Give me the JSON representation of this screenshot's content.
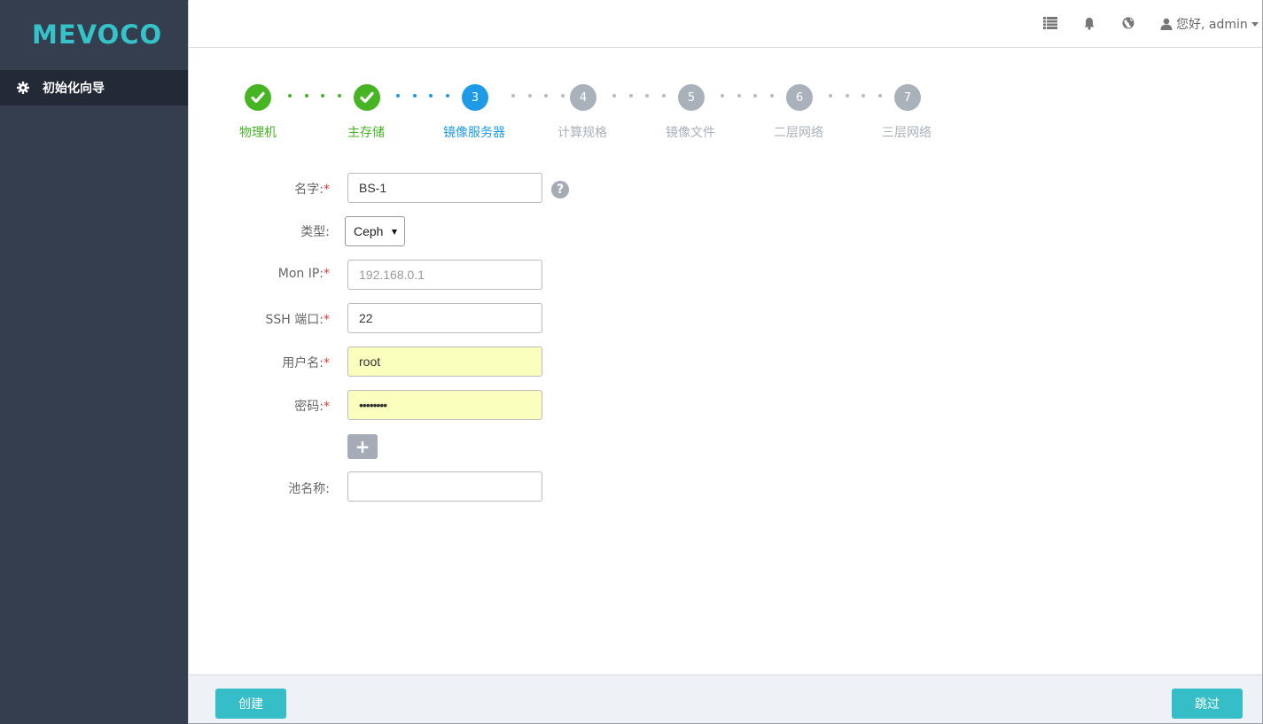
{
  "brand": {
    "logo_text": "MEVOCO",
    "accent": "#35c2c9"
  },
  "sidebar": {
    "items": [
      {
        "label": "初始化向导",
        "icon": "gear-icon"
      }
    ]
  },
  "header": {
    "icons": [
      "list-icon",
      "bell-icon",
      "globe-icon",
      "user-icon"
    ],
    "user_label": "您好, admin"
  },
  "wizard": {
    "steps": [
      {
        "marker": "",
        "label": "物理机",
        "state": "done"
      },
      {
        "marker": "",
        "label": "主存储",
        "state": "done"
      },
      {
        "marker": "3",
        "label": "镜像服务器",
        "state": "active"
      },
      {
        "marker": "4",
        "label": "计算规格",
        "state": "todo"
      },
      {
        "marker": "5",
        "label": "镜像文件",
        "state": "todo"
      },
      {
        "marker": "6",
        "label": "二层网络",
        "state": "todo"
      },
      {
        "marker": "7",
        "label": "三层网络",
        "state": "todo"
      }
    ],
    "colors": {
      "done": "#46b423",
      "active": "#1e9be7",
      "todo": "#a9b1bb"
    }
  },
  "form": {
    "name": {
      "label": "名字:",
      "required": "*",
      "value": "BS-1"
    },
    "type": {
      "label": "类型:",
      "value": "Ceph"
    },
    "mon_ip": {
      "label": "Mon IP:",
      "required": "*",
      "placeholder": "192.168.0.1"
    },
    "ssh_port": {
      "label": "SSH 端口:",
      "required": "*",
      "value": "22"
    },
    "username": {
      "label": "用户名:",
      "required": "*",
      "value": "root"
    },
    "password": {
      "label": "密码:",
      "required": "*",
      "value": "••••••••"
    },
    "add_symbol": "+",
    "pool_name": {
      "label": "池名称:",
      "value": ""
    },
    "help_symbol": "?"
  },
  "footer": {
    "create_label": "创建",
    "skip_label": "跳过"
  }
}
